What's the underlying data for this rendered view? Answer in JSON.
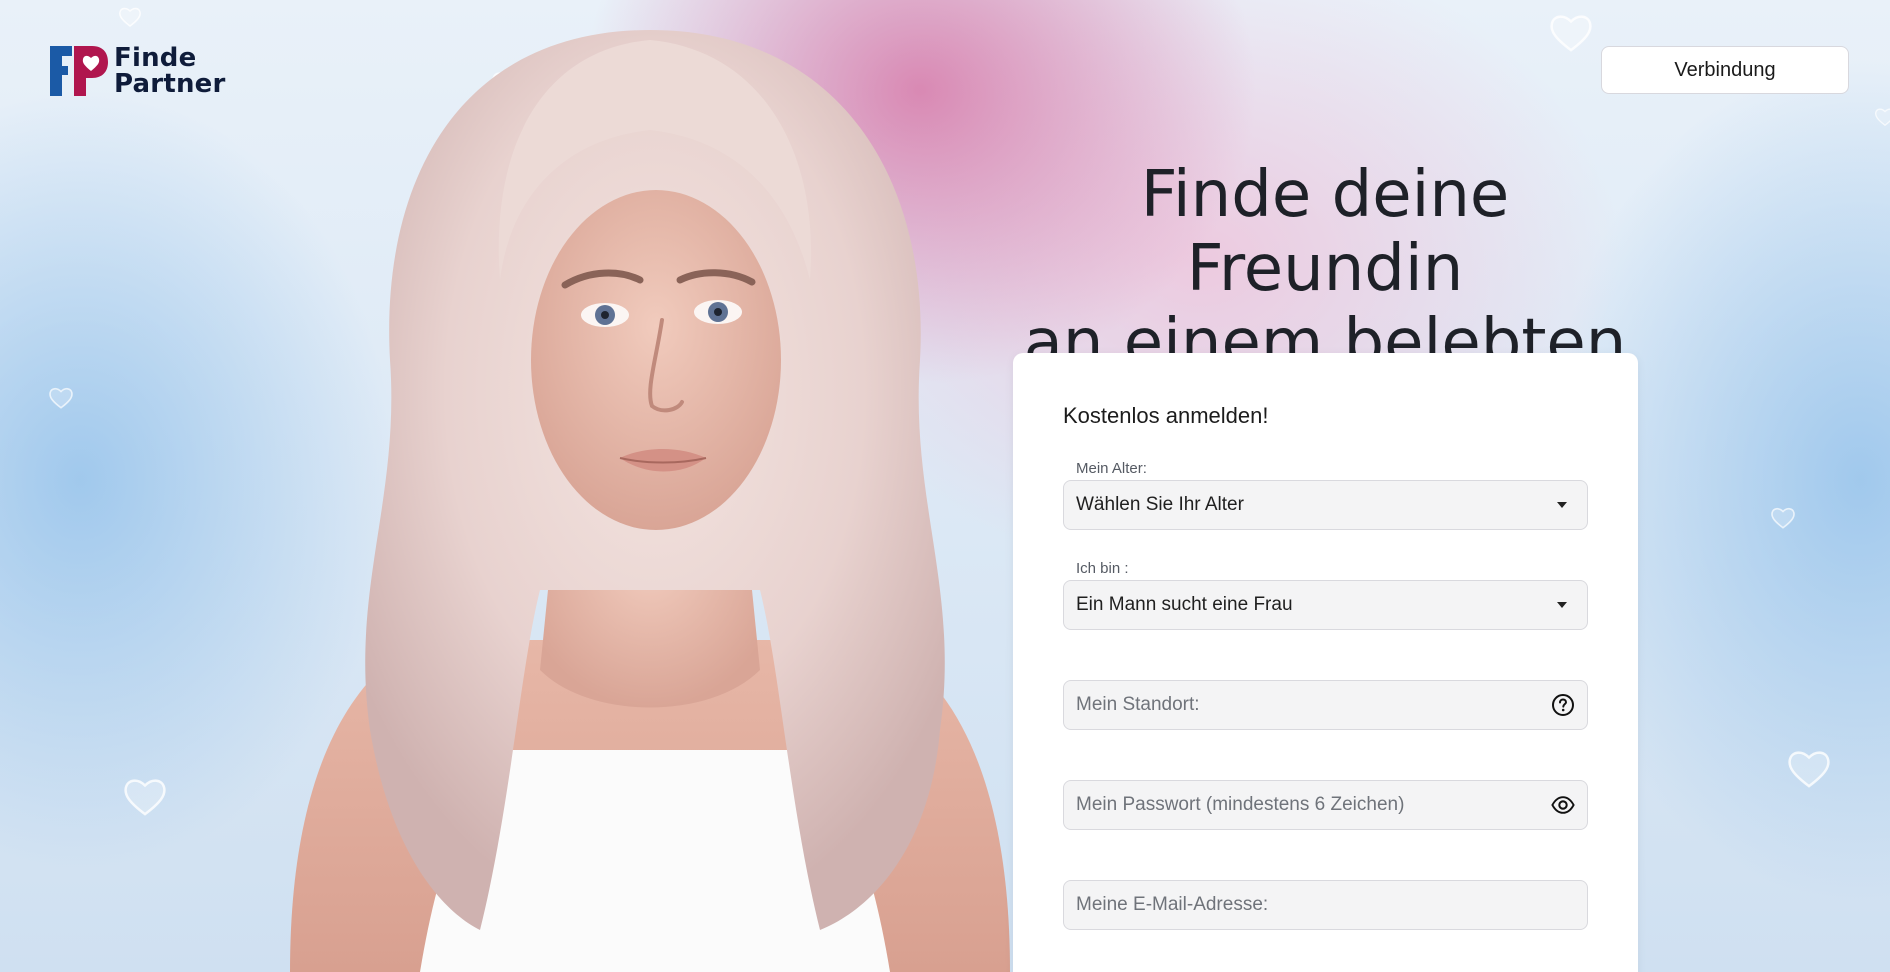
{
  "header": {
    "logo": {
      "line1": "Finde",
      "line2": "Partner"
    },
    "connect_button": "Verbindung"
  },
  "hero": {
    "headline_line1": "Finde deine Freundin",
    "headline_line2": "an einem belebten Ort"
  },
  "form": {
    "title": "Kostenlos anmelden!",
    "age": {
      "label": "Mein Alter:",
      "value": "Wählen Sie Ihr Alter"
    },
    "gender": {
      "label": "Ich bin :",
      "value": "Ein Mann sucht eine Frau"
    },
    "location": {
      "placeholder": "Mein Standort:"
    },
    "password": {
      "placeholder": "Mein Passwort (mindestens 6 Zeichen)"
    },
    "email": {
      "placeholder": "Meine E-Mail-Adresse:"
    }
  },
  "colors": {
    "brand_navy": "#0f1c3a",
    "brand_blue": "#1b5aa6",
    "brand_magenta": "#b0164e",
    "background_pink": "#d678a8",
    "background_blue": "#96c3eb"
  },
  "icons": {
    "location_help": "question-circle-icon",
    "password_visibility": "eye-icon",
    "select_caret": "caret-down-icon",
    "logo_heart": "heart-icon"
  }
}
